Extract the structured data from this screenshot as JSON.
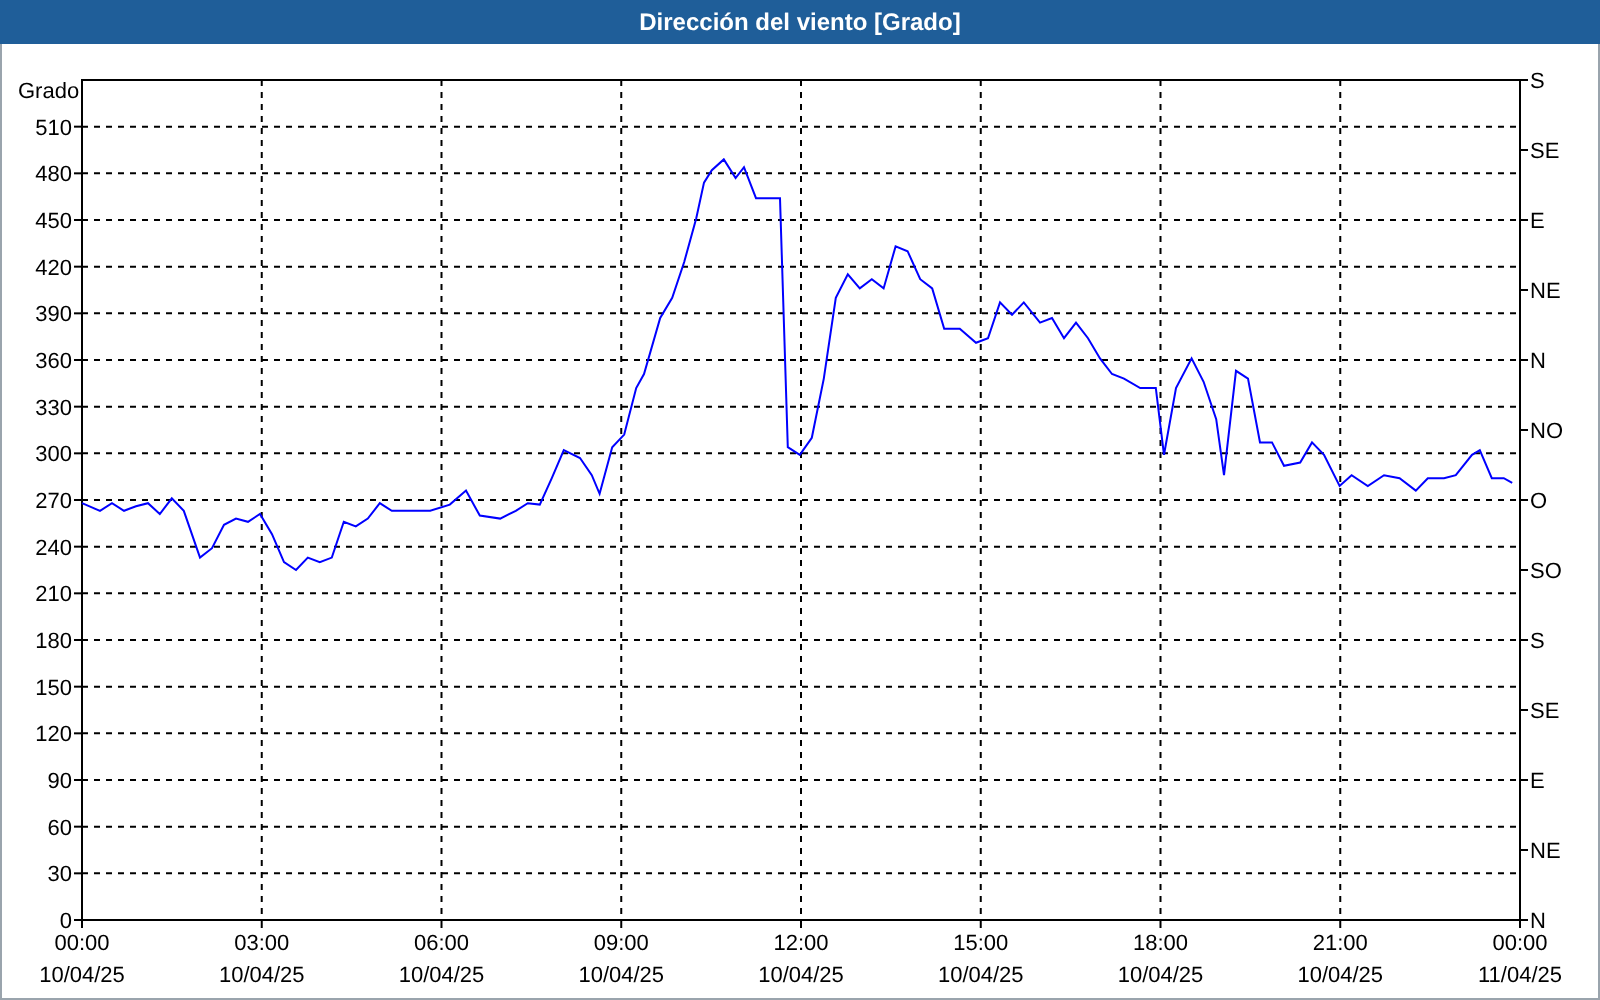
{
  "window": {
    "title": "Dirección del viento [Grado]"
  },
  "chart": {
    "x_axis_dates": [
      "10/04/25",
      "10/04/25",
      "10/04/25",
      "10/04/25",
      "10/04/25",
      "10/04/25",
      "10/04/25",
      "10/04/25",
      "11/04/25"
    ],
    "right_axis_labels": [
      "S",
      "SE",
      "E",
      "NE",
      "N",
      "NO",
      "O",
      "SO",
      "S",
      "SE",
      "E",
      "NE",
      "N"
    ],
    "chart_data": {
      "type": "line",
      "grid": true,
      "ylabel": "Grado",
      "xlim": [
        0,
        24
      ],
      "ylim": [
        0,
        540
      ],
      "yticks": [
        0,
        30,
        60,
        90,
        120,
        150,
        180,
        210,
        240,
        270,
        300,
        330,
        360,
        390,
        420,
        450,
        480,
        510
      ],
      "xticks": [
        {
          "value": 0,
          "label": "00:00"
        },
        {
          "value": 3,
          "label": "03:00"
        },
        {
          "value": 6,
          "label": "06:00"
        },
        {
          "value": 9,
          "label": "09:00"
        },
        {
          "value": 12,
          "label": "12:00"
        },
        {
          "value": 15,
          "label": "15:00"
        },
        {
          "value": 18,
          "label": "18:00"
        },
        {
          "value": 21,
          "label": "21:00"
        },
        {
          "value": 24,
          "label": "00:00"
        }
      ],
      "x": [
        0,
        0.3,
        0.5,
        0.7,
        0.9,
        1.1,
        1.3,
        1.5,
        1.7,
        1.97,
        2.17,
        2.37,
        2.57,
        2.77,
        2.97,
        3.17,
        3.37,
        3.57,
        3.77,
        3.97,
        4.17,
        4.37,
        4.57,
        4.77,
        4.97,
        5.17,
        5.47,
        5.81,
        6.14,
        6.41,
        6.64,
        6.98,
        7.24,
        7.44,
        7.64,
        7.84,
        8.04,
        8.31,
        8.51,
        8.64,
        8.85,
        9.05,
        9.25,
        9.38,
        9.65,
        9.85,
        10.05,
        10.25,
        10.38,
        10.51,
        10.71,
        10.91,
        11.05,
        11.25,
        11.52,
        11.65,
        11.78,
        11.98,
        12.18,
        12.38,
        12.58,
        12.78,
        12.98,
        13.18,
        13.38,
        13.58,
        13.78,
        13.99,
        14.19,
        14.39,
        14.65,
        14.92,
        15.12,
        15.32,
        15.52,
        15.72,
        15.99,
        16.19,
        16.39,
        16.59,
        16.79,
        16.99,
        17.19,
        17.39,
        17.66,
        17.92,
        18.06,
        18.26,
        18.52,
        18.72,
        18.93,
        19.06,
        19.26,
        19.46,
        19.66,
        19.86,
        20.06,
        20.33,
        20.53,
        20.73,
        20.99,
        21.19,
        21.46,
        21.73,
        21.99,
        22.26,
        22.46,
        22.73,
        22.93,
        23.2,
        23.33,
        23.53,
        23.73,
        23.87
      ],
      "series": [
        {
          "color": "#0000ff",
          "values": [
            268,
            263,
            268,
            263,
            266,
            268,
            261,
            271,
            263,
            233,
            239,
            254,
            258,
            256,
            261,
            248,
            230,
            225,
            233,
            230,
            233,
            256,
            253,
            258,
            268,
            263,
            263,
            263,
            267,
            276,
            260,
            258,
            263,
            268,
            267,
            284,
            302,
            297,
            286,
            274,
            304,
            312,
            342,
            351,
            387,
            400,
            423,
            451,
            474,
            482,
            489,
            477,
            484,
            464,
            464,
            464,
            304,
            299,
            310,
            348,
            400,
            415,
            406,
            412,
            406,
            433,
            430,
            412,
            406,
            380,
            380,
            371,
            374,
            397,
            389,
            397,
            384,
            387,
            374,
            384,
            374,
            361,
            351,
            348,
            342,
            342,
            299,
            342,
            361,
            346,
            322,
            286,
            353,
            348,
            307,
            307,
            292,
            294,
            307,
            299,
            279,
            286,
            279,
            286,
            284,
            276,
            284,
            284,
            286,
            299,
            302,
            284,
            284,
            281
          ]
        }
      ]
    }
  }
}
